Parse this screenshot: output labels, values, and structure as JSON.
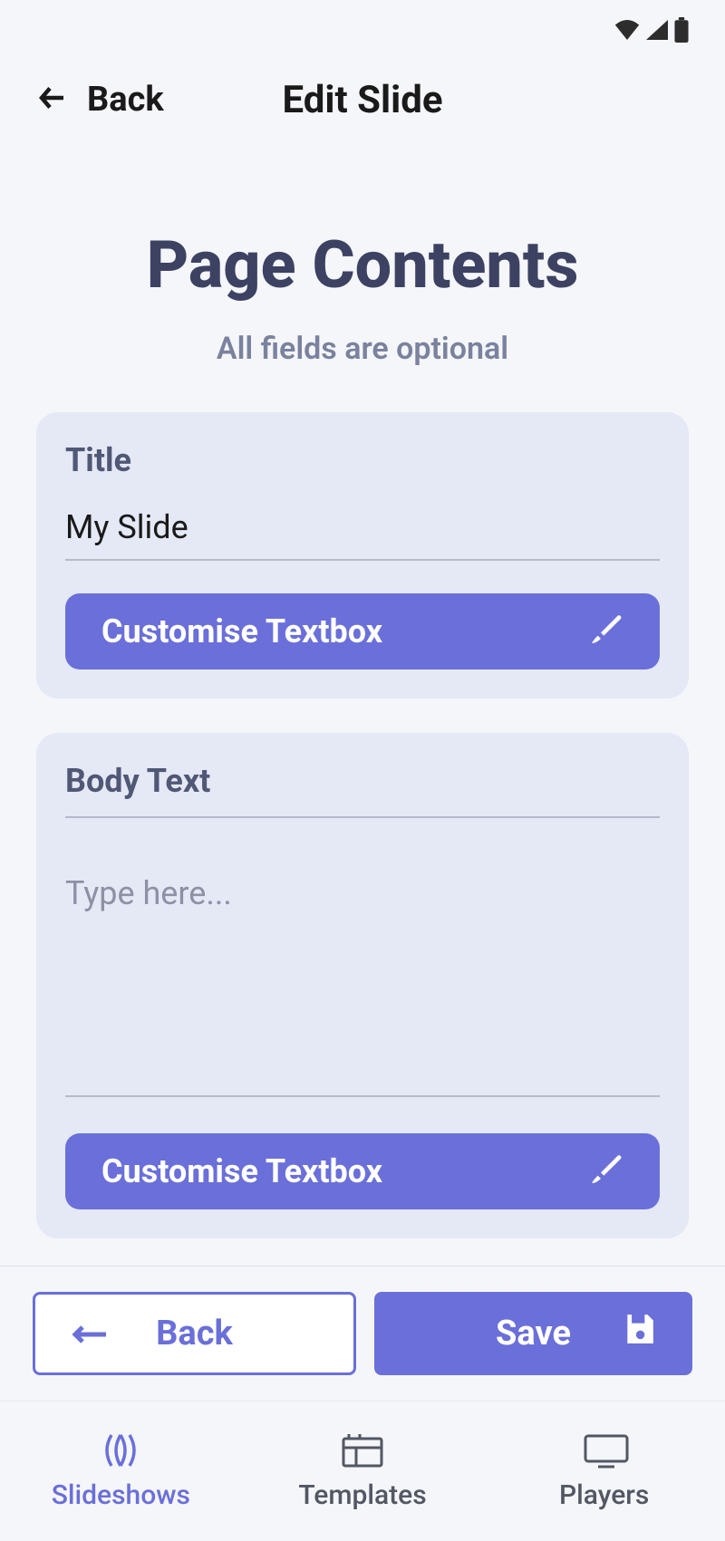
{
  "topNav": {
    "back_label": "Back",
    "title": "Edit Slide"
  },
  "main": {
    "heading": "Page Contents",
    "subheading": "All fields are optional"
  },
  "cards": {
    "title": {
      "label": "Title",
      "value": "My Slide",
      "customise_label": "Customise Textbox"
    },
    "body": {
      "label": "Body Text",
      "placeholder": "Type here...",
      "value": "",
      "customise_label": "Customise Textbox"
    }
  },
  "actions": {
    "back_label": "Back",
    "save_label": "Save"
  },
  "bottomNav": {
    "items": [
      {
        "label": "Slideshows",
        "active": true
      },
      {
        "label": "Templates",
        "active": false
      },
      {
        "label": "Players",
        "active": false
      }
    ]
  }
}
